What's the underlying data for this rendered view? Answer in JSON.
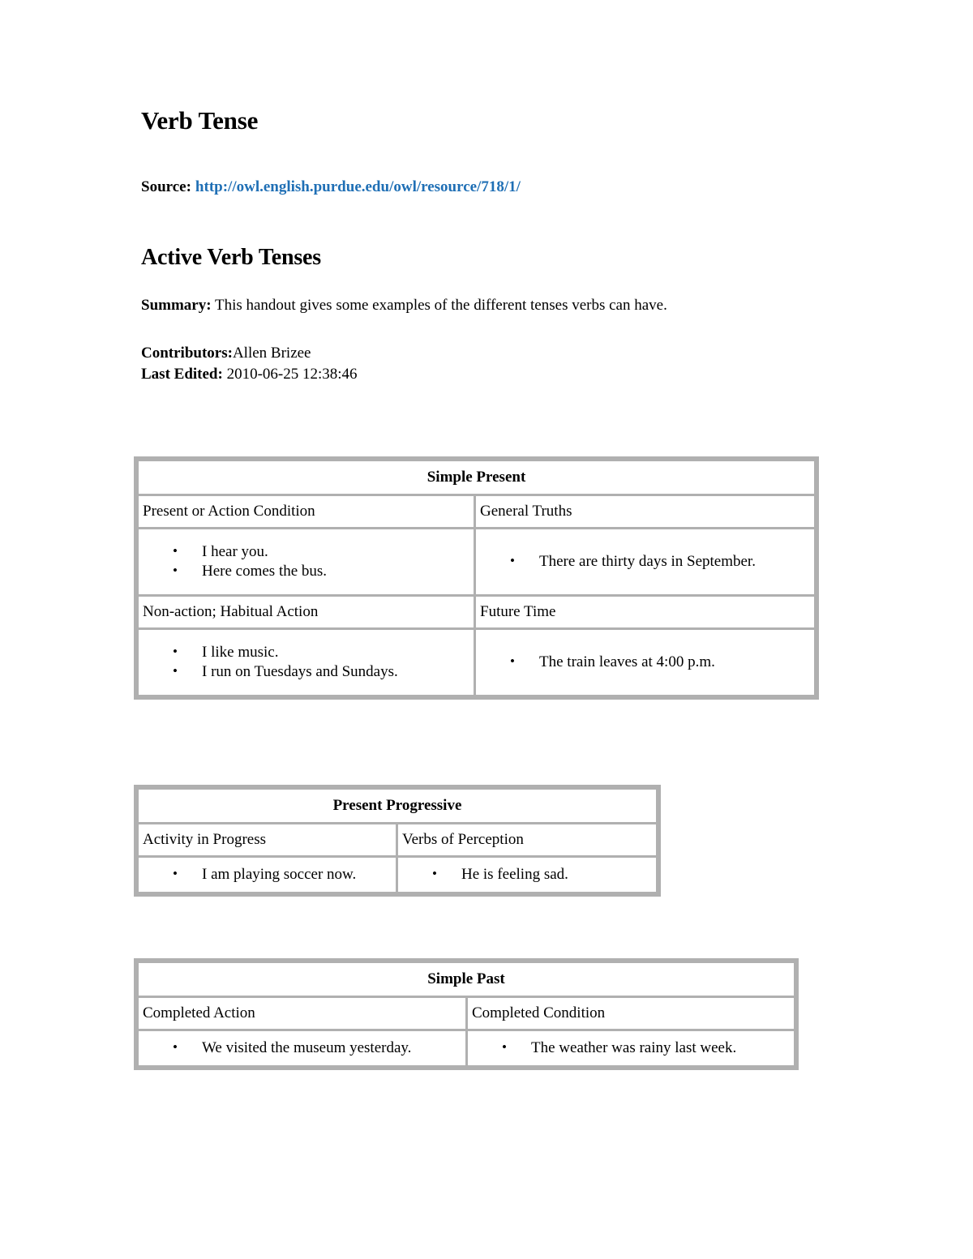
{
  "document": {
    "title": "Verb Tense",
    "source_label": "Source:",
    "source_url": "http://owl.english.purdue.edu/owl/resource/718/1/",
    "section_title": "Active Verb Tenses",
    "summary_label": "Summary:",
    "summary_text": " This handout gives some examples of the different tenses verbs can have.",
    "contributors_label": "Contributors:",
    "contributors_value": "Allen Brizee",
    "last_edited_label": "Last Edited:",
    "last_edited_value": " 2010-06-25 12:38:46",
    "link_color": "#1f6fb5",
    "border_color": "#b0b0b0"
  },
  "tables": {
    "simple_present": {
      "title": "Simple Present",
      "header_left": "Present or Action Condition",
      "header_right": "General Truths",
      "left_items": [
        "I hear you.",
        "Here comes the bus."
      ],
      "right_items": [
        "There are thirty days in September."
      ],
      "header_left_2": "Non-action; Habitual Action",
      "header_right_2": "Future Time",
      "left_items_2": [
        "I like music.",
        "I run on Tuesdays and Sundays."
      ],
      "right_items_2": [
        "The train leaves at 4:00 p.m."
      ]
    },
    "present_progressive": {
      "title": "Present Progressive",
      "header_left": "Activity in Progress",
      "header_right": "Verbs of Perception",
      "left_items": [
        "I am playing soccer now."
      ],
      "right_items": [
        "He is feeling sad."
      ]
    },
    "simple_past": {
      "title": "Simple Past",
      "header_left": "Completed Action",
      "header_right": "Completed Condition",
      "left_items": [
        "We visited the museum yesterday."
      ],
      "right_items": [
        "The weather was rainy last week."
      ]
    }
  }
}
